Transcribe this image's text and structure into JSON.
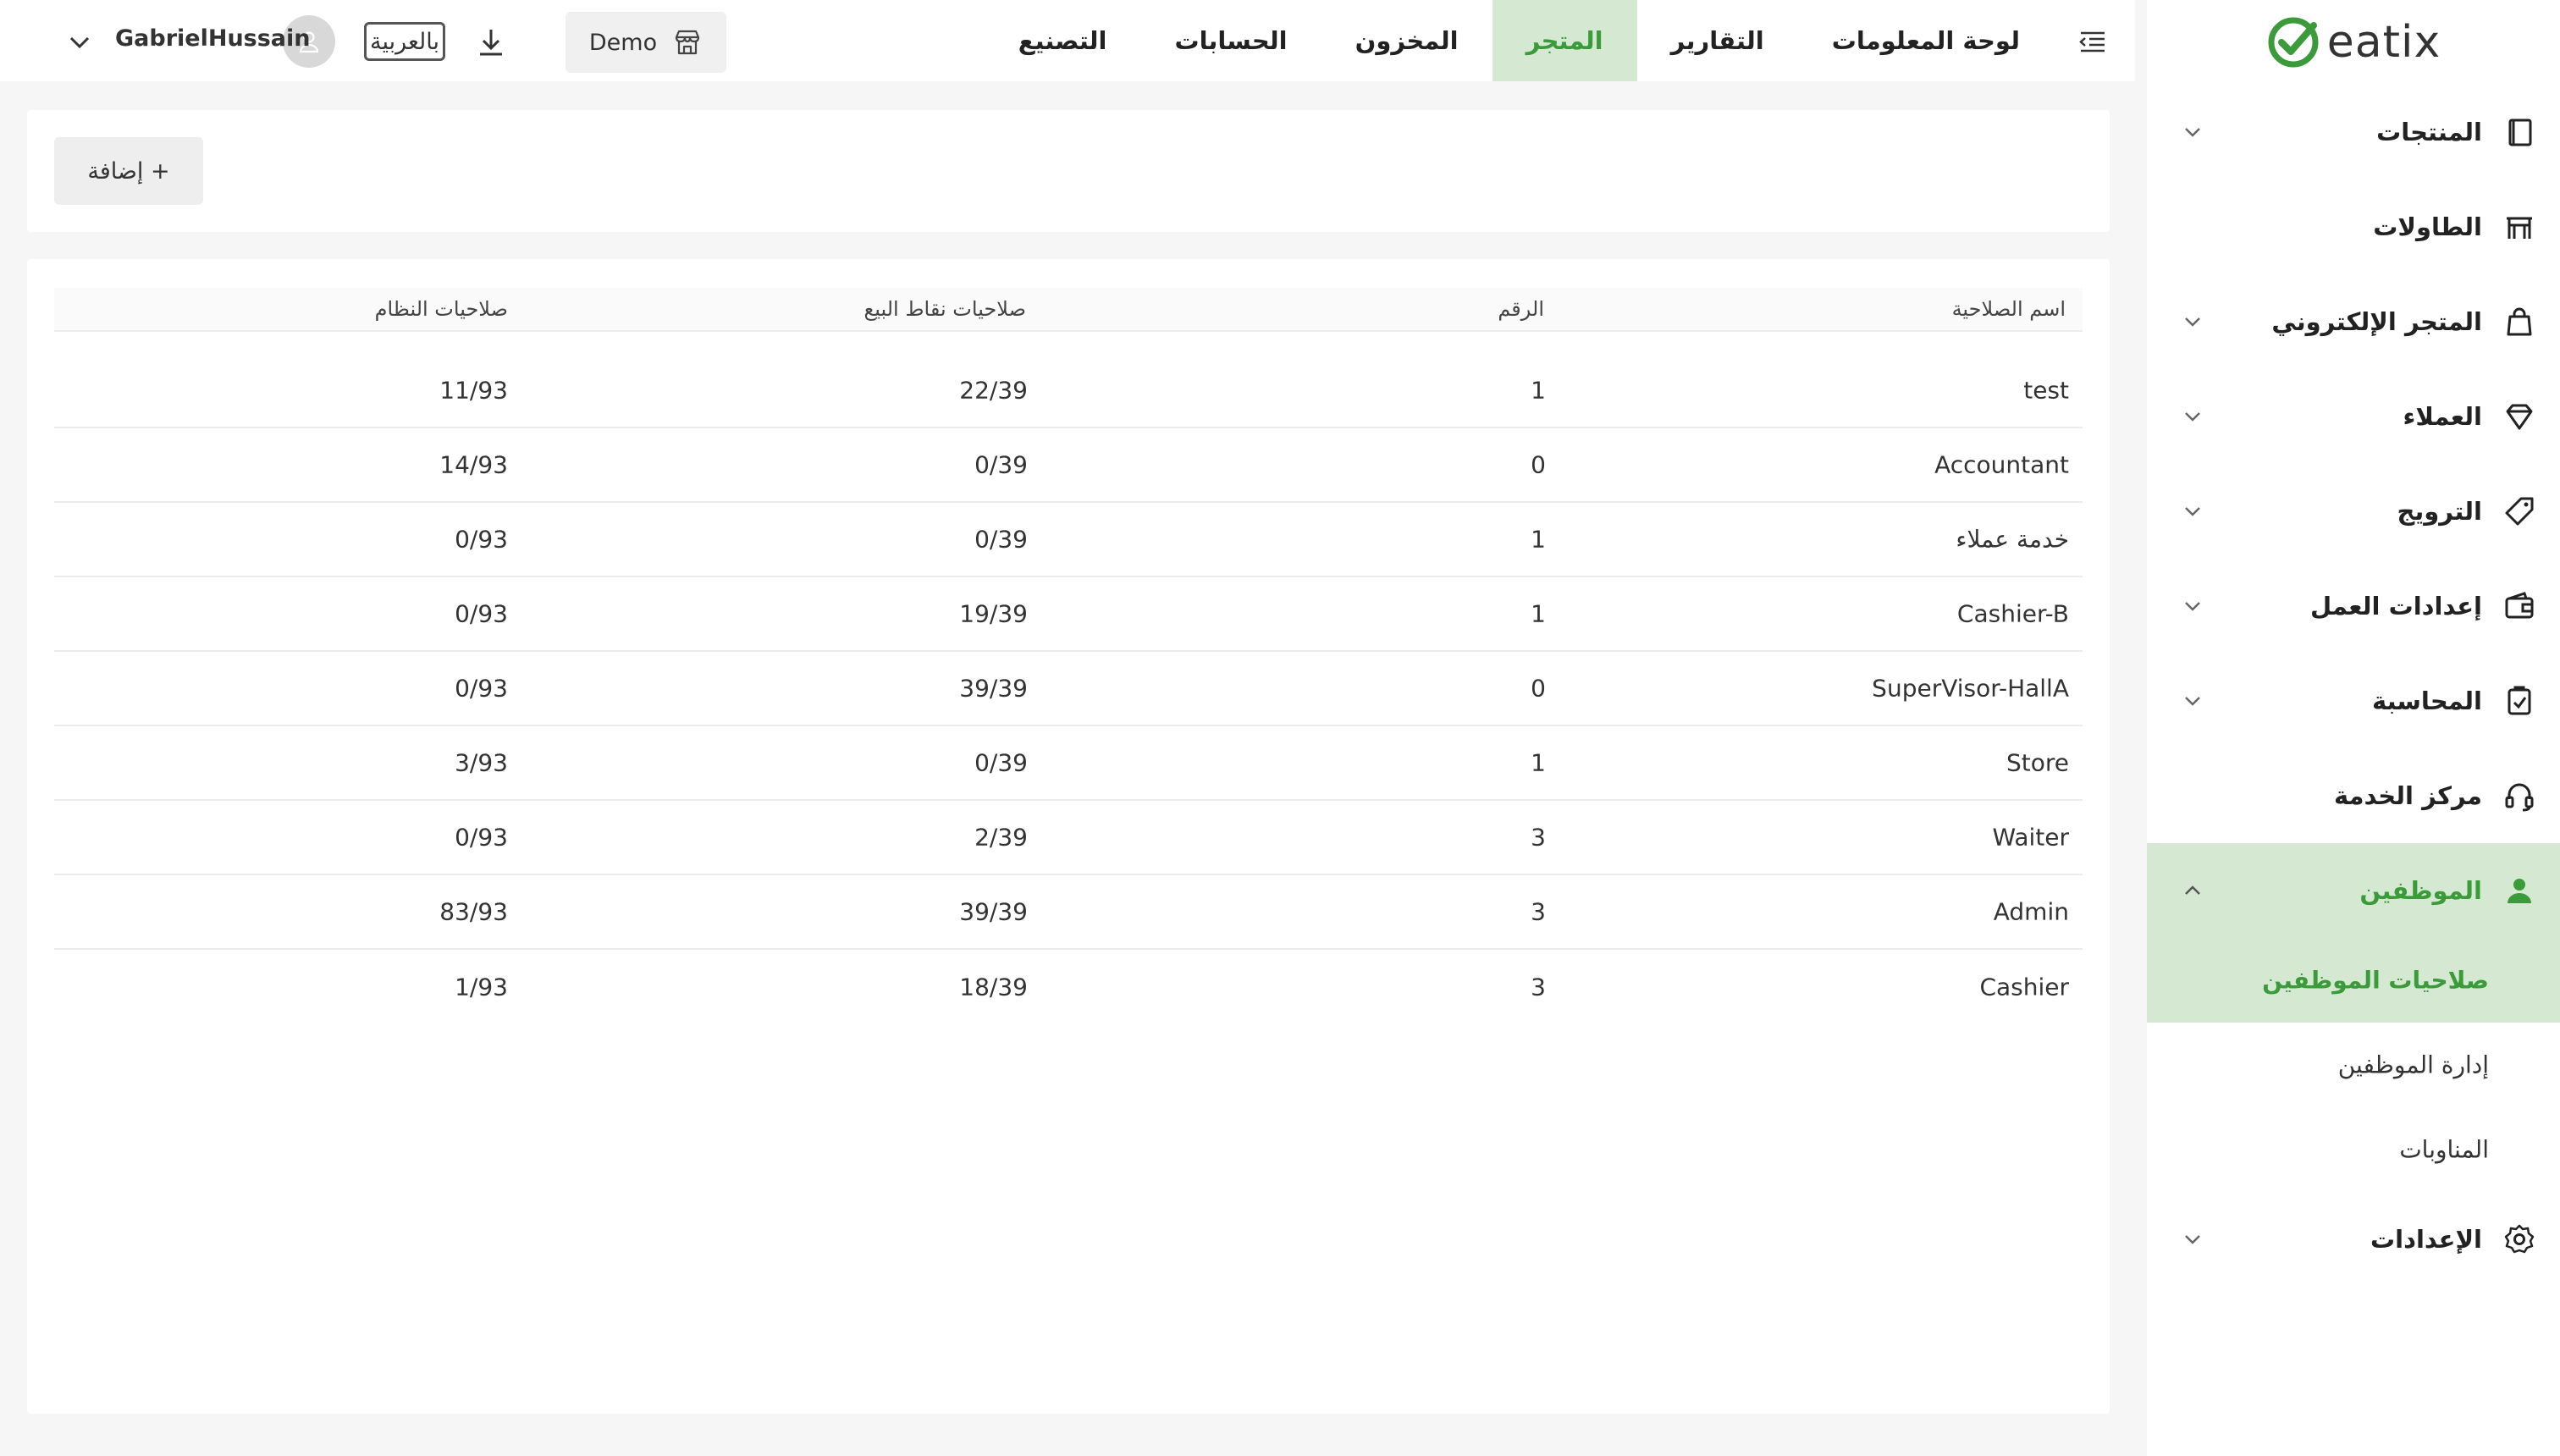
{
  "app": {
    "logo_text": "eatix",
    "brand_color": "#3b9a3a",
    "active_bg": "#d5e9d2"
  },
  "sidebar": {
    "items": [
      {
        "label": "المنتجات",
        "icon": "book-icon",
        "has_chevron": true
      },
      {
        "label": "الطاولات",
        "icon": "table-icon",
        "has_chevron": false
      },
      {
        "label": "المتجر الإلكتروني",
        "icon": "shopping-bag-icon",
        "has_chevron": true
      },
      {
        "label": "العملاء",
        "icon": "gem-icon",
        "has_chevron": true
      },
      {
        "label": "الترويج",
        "icon": "tag-icon",
        "has_chevron": true
      },
      {
        "label": "إعدادات العمل",
        "icon": "wallet-icon",
        "has_chevron": true
      },
      {
        "label": "المحاسبة",
        "icon": "clipboard-check-icon",
        "has_chevron": true
      },
      {
        "label": "مركز الخدمة",
        "icon": "headset-icon",
        "has_chevron": false
      },
      {
        "label": "الموظفين",
        "icon": "user-icon",
        "has_chevron": true,
        "expanded": true
      },
      {
        "label": "الإعدادات",
        "icon": "gear-icon",
        "has_chevron": true
      }
    ],
    "employees_sub": [
      {
        "label": "صلاحيات الموظفين",
        "active": true
      },
      {
        "label": "إدارة الموظفين",
        "active": false
      },
      {
        "label": "المناوبات",
        "active": false
      }
    ]
  },
  "topbar": {
    "tabs": [
      {
        "label": "لوحة المعلومات",
        "active": false
      },
      {
        "label": "التقارير",
        "active": false
      },
      {
        "label": "المتجر",
        "active": true
      },
      {
        "label": "المخزون",
        "active": false
      },
      {
        "label": "الحسابات",
        "active": false
      },
      {
        "label": "التصنيع",
        "active": false
      }
    ],
    "store_label": "Demo",
    "language_label": "بالعربية",
    "username": "GabrielHussain"
  },
  "toolbar": {
    "add_label": "+ إضافة"
  },
  "table": {
    "headers": {
      "name": "اسم الصلاحية",
      "number": "الرقم",
      "pos_permissions": "صلاحيات نقاط البيع",
      "system_permissions": "صلاحيات النظام"
    },
    "rows": [
      {
        "name": "test",
        "number": "1",
        "pos": "22/39",
        "system": "11/93"
      },
      {
        "name": "Accountant",
        "number": "0",
        "pos": "0/39",
        "system": "14/93"
      },
      {
        "name": "خدمة عملاء",
        "number": "1",
        "pos": "0/39",
        "system": "0/93"
      },
      {
        "name": "Cashier-B",
        "number": "1",
        "pos": "19/39",
        "system": "0/93"
      },
      {
        "name": "SuperVisor-HallA",
        "number": "0",
        "pos": "39/39",
        "system": "0/93"
      },
      {
        "name": "Store",
        "number": "1",
        "pos": "0/39",
        "system": "3/93"
      },
      {
        "name": "Waiter",
        "number": "3",
        "pos": "2/39",
        "system": "0/93"
      },
      {
        "name": "Admin",
        "number": "3",
        "pos": "39/39",
        "system": "83/93"
      },
      {
        "name": "Cashier",
        "number": "3",
        "pos": "18/39",
        "system": "1/93"
      }
    ]
  }
}
